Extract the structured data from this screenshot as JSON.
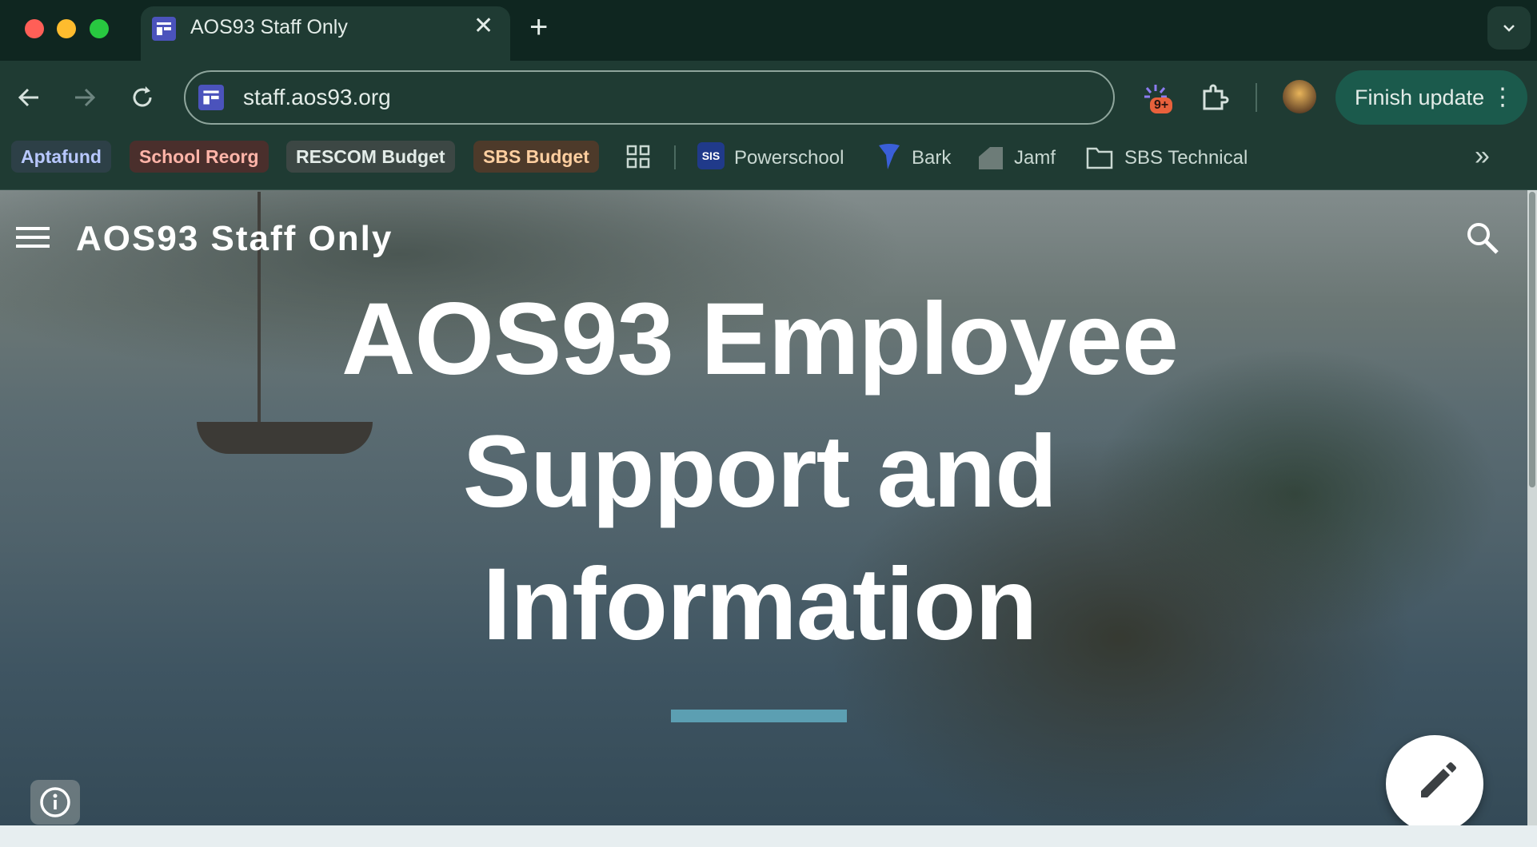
{
  "browser": {
    "tab": {
      "title": "AOS93 Staff Only",
      "close": "✕"
    },
    "new_tab": "+",
    "tab_search": "⌄",
    "url": "staff.aos93.org",
    "extension_badge": "9+",
    "finish_update": "Finish update",
    "more": "⋮"
  },
  "bookmarks": {
    "chips": [
      {
        "label": "Aptafund",
        "bg": "#2d4047",
        "fg": "#b8c8ff"
      },
      {
        "label": "School Reorg",
        "bg": "#4a2f2c",
        "fg": "#ffb4a8"
      },
      {
        "label": "RESCOM Budget",
        "bg": "#3c4744",
        "fg": "#e3ece8"
      },
      {
        "label": "SBS Budget",
        "bg": "#4d3a2a",
        "fg": "#ffcfa0"
      }
    ],
    "items": [
      {
        "label": "Powerschool",
        "icon": "sis-icon"
      },
      {
        "label": "Bark",
        "icon": "bark-icon"
      },
      {
        "label": "Jamf",
        "icon": "jamf-icon"
      },
      {
        "label": "SBS Technical",
        "icon": "folder-icon"
      }
    ],
    "sis_badge": "SIS",
    "overflow": "»"
  },
  "page": {
    "site_title": "AOS93 Staff Only",
    "headline_lines": [
      "AOS93 Employee",
      "Support and",
      "Information"
    ],
    "accent_color": "#5c9fb2"
  }
}
